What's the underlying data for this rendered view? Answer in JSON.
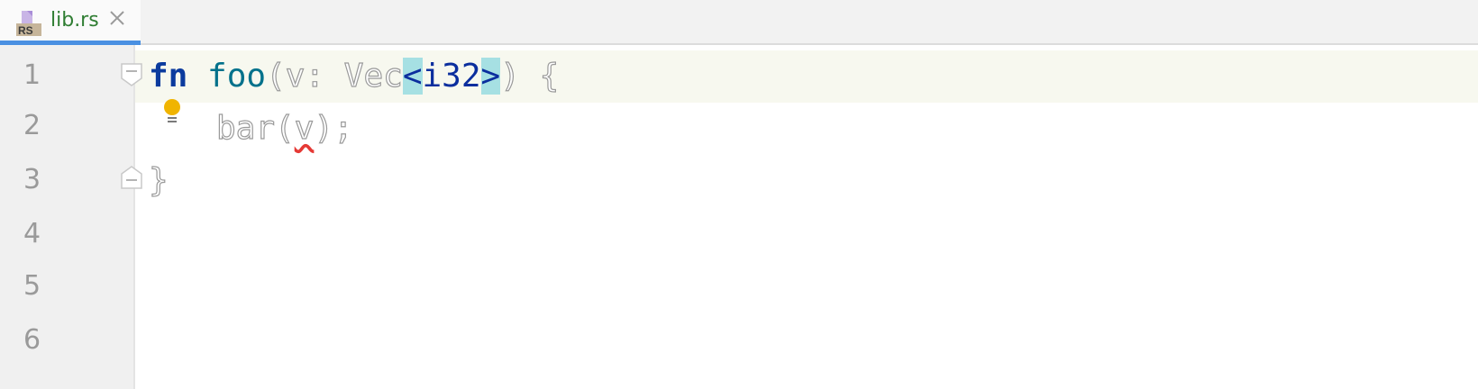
{
  "tab": {
    "filename": "lib.rs",
    "icon_label": "RS",
    "icon": "rust-file-icon",
    "close_icon": "close-icon",
    "active_color": "#4a90e2"
  },
  "gutter": {
    "line_numbers": [
      "1",
      "2",
      "3",
      "4",
      "5",
      "6"
    ]
  },
  "code": {
    "line1": {
      "fn_kw": "fn",
      "fn_name": "foo",
      "open_paren": "(",
      "param": "v: Vec",
      "lt": "<",
      "type": "i32",
      "gt": ">",
      "close": ") {"
    },
    "line2": {
      "call": "bar(",
      "arg": "v",
      "end": ");"
    },
    "line3": {
      "brace": "}"
    }
  },
  "icons": {
    "intention": "lightbulb-icon",
    "fold": "fold-marker-icon"
  },
  "colors": {
    "keyword": "#0b3b9e",
    "function": "#00718b",
    "bracket_highlight": "#a6e0e3",
    "error": "#e53935",
    "bulb": "#f0b400"
  }
}
